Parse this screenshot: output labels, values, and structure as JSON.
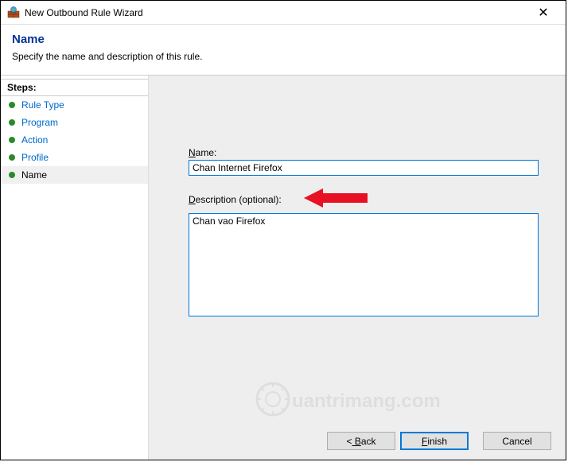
{
  "window": {
    "title": "New Outbound Rule Wizard",
    "close": "✕"
  },
  "header": {
    "title": "Name",
    "subtitle": "Specify the name and description of this rule."
  },
  "sidebar": {
    "steps_label": "Steps:",
    "items": [
      {
        "label": "Rule Type"
      },
      {
        "label": "Program"
      },
      {
        "label": "Action"
      },
      {
        "label": "Profile"
      },
      {
        "label": "Name"
      }
    ],
    "current_index": 4
  },
  "form": {
    "name_label_pre": "N",
    "name_label_rest": "ame:",
    "name_value": "Chan Internet Firefox",
    "desc_label_pre": "D",
    "desc_label_rest": "escription (optional):",
    "desc_value": "Chan vao Firefox"
  },
  "buttons": {
    "back_lt": "<",
    "back_pre": " B",
    "back_rest": "ack",
    "finish_pre": "F",
    "finish_rest": "inish",
    "cancel": "Cancel"
  },
  "watermark": {
    "text": "uantrimang.com"
  }
}
